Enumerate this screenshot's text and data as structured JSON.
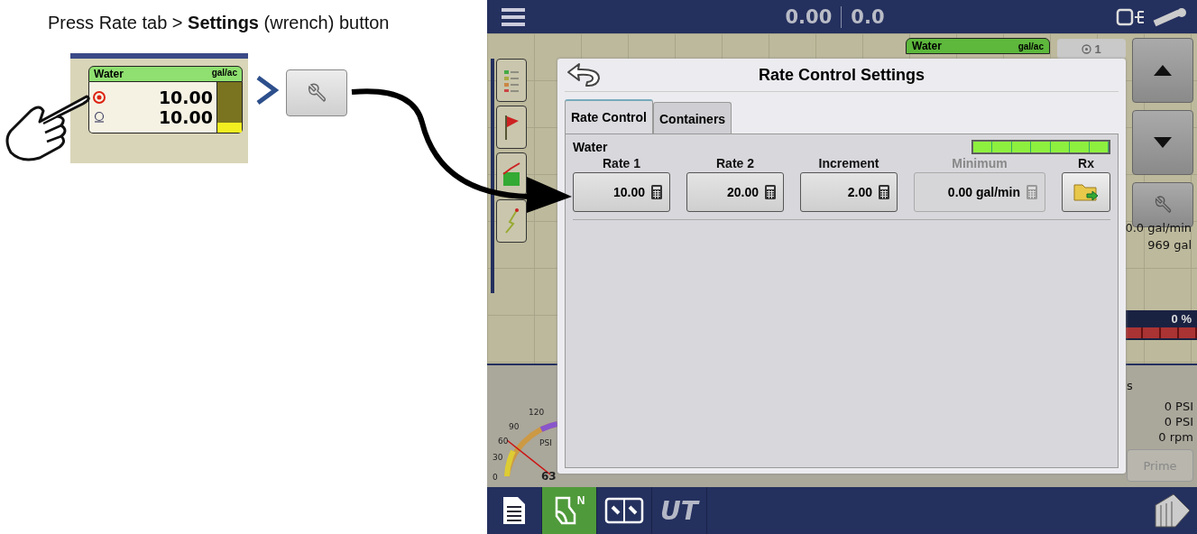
{
  "instruction": "Press Rate tab > **Settings** (wrench) button",
  "inset": {
    "product": "Water",
    "unit": "gal/ac",
    "target_rate": "10.00",
    "actual_rate": "10.00",
    "level": 0.2
  },
  "screen": {
    "top_bar": {
      "readings": [
        "0.00",
        "0.0"
      ]
    },
    "product_tab": {
      "name": "Water",
      "unit": "gal/ac"
    },
    "section_counter": "1",
    "right_readings": [
      "0.0 gal/min",
      "969 gal"
    ],
    "progress": {
      "text": "0 %"
    },
    "lower_panel": {
      "cut_label": "s",
      "readings": [
        "0 PSI",
        "0 PSI",
        "0 rpm"
      ],
      "prime_button": "Prime"
    },
    "gauge": {
      "ticks": [
        "120",
        "90",
        "60",
        "30",
        "0"
      ],
      "unit": "PSI",
      "value": "63"
    },
    "dialog": {
      "title": "Rate Control Settings",
      "tabs": [
        {
          "label": "Rate Control",
          "selected": true
        },
        {
          "label": "Containers",
          "selected": false
        }
      ],
      "product": "Water",
      "fields": [
        {
          "kind": "number",
          "label": "Rate 1",
          "value": "10.00",
          "disabled": false
        },
        {
          "kind": "number",
          "label": "Rate 2",
          "value": "20.00",
          "disabled": false
        },
        {
          "kind": "number",
          "label": "Increment",
          "value": "2.00",
          "disabled": false
        },
        {
          "kind": "number",
          "label": "Minimum",
          "value": "0.00 gal/min",
          "disabled": true
        },
        {
          "kind": "rx",
          "label": "Rx",
          "disabled": false
        }
      ]
    },
    "bottom_nav": [
      {
        "kind": "document",
        "selected": false
      },
      {
        "kind": "map",
        "badge": "N",
        "selected": true
      },
      {
        "kind": "split",
        "selected": false
      },
      {
        "kind": "ut",
        "text": "UT",
        "selected": false
      }
    ]
  }
}
